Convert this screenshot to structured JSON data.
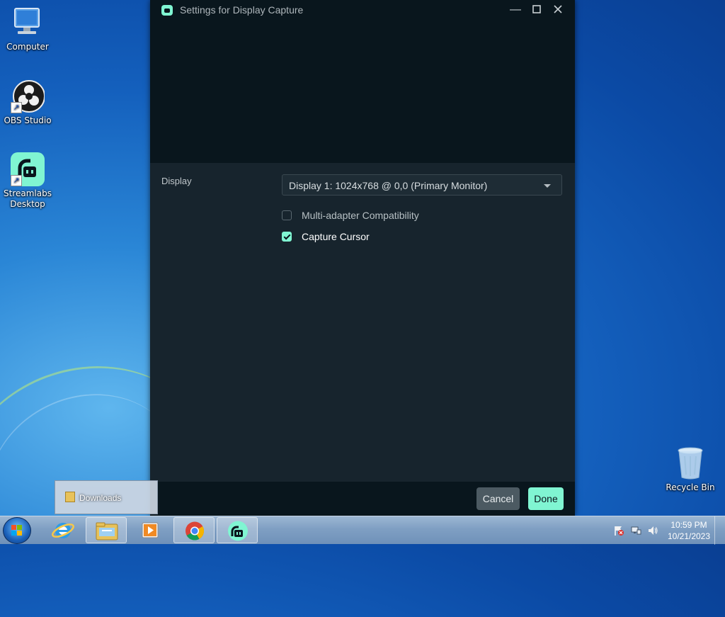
{
  "desktop": {
    "icons": [
      {
        "label": "Computer"
      },
      {
        "label": "OBS Studio"
      },
      {
        "label": "Streamlabs Desktop"
      },
      {
        "label": "Recycle Bin"
      }
    ]
  },
  "dialog": {
    "title": "Settings for Display Capture",
    "display_label": "Display",
    "display_value": "Display 1: 1024x768 @ 0,0 (Primary Monitor)",
    "options": [
      {
        "label": "Multi-adapter Compatibility",
        "checked": false
      },
      {
        "label": "Capture Cursor",
        "checked": true
      }
    ],
    "cancel_label": "Cancel",
    "done_label": "Done"
  },
  "popup": {
    "label": "Downloads"
  },
  "taskbar": {
    "items": [
      "start",
      "internet-explorer",
      "windows-explorer",
      "media-player",
      "chrome",
      "streamlabs"
    ],
    "clock_time": "10:59 PM",
    "clock_date": "10/21/2023"
  },
  "colors": {
    "accent": "#80f5d2",
    "window_bg": "#17242d",
    "window_dark": "#09161d"
  }
}
